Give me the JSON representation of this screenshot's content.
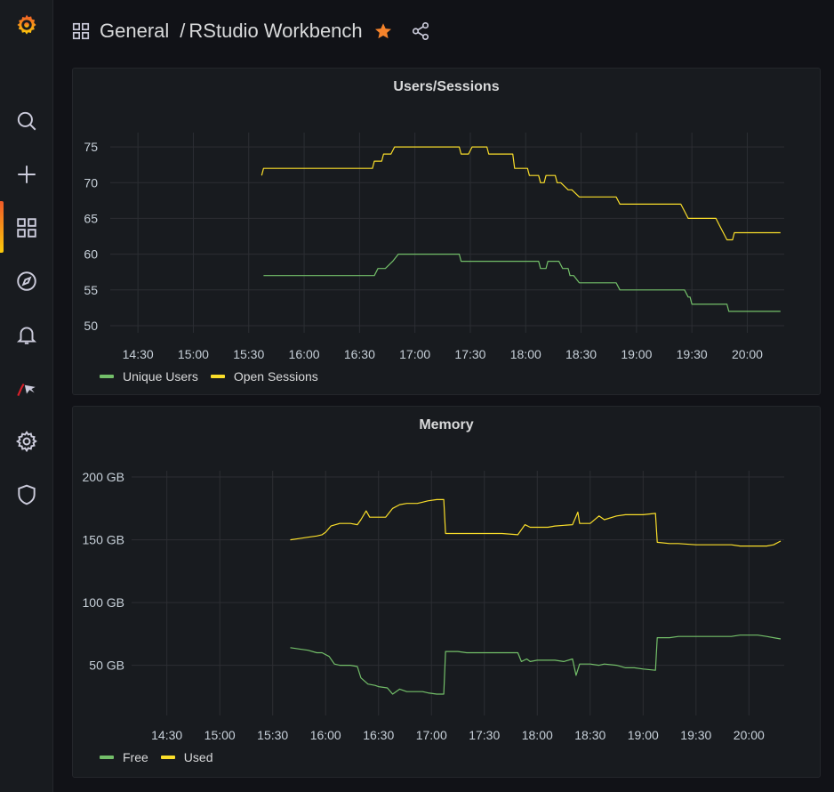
{
  "breadcrumb": {
    "folder": "General",
    "separator": "/",
    "title": "RStudio Workbench"
  },
  "colors": {
    "green": "#73bf69",
    "yellow": "#fade2a",
    "grid": "#2c2e33",
    "orange": "#f5832b"
  },
  "sidebar": {
    "items": [
      {
        "icon": "search-icon"
      },
      {
        "icon": "plus-icon"
      },
      {
        "icon": "dashboards-icon"
      },
      {
        "icon": "explore-icon"
      },
      {
        "icon": "bell-icon"
      },
      {
        "icon": "rstudio-logo-icon"
      },
      {
        "icon": "gear-icon"
      },
      {
        "icon": "shield-icon"
      }
    ]
  },
  "panels": [
    {
      "title": "Users/Sessions",
      "legend": [
        "Unique Users",
        "Open Sessions"
      ],
      "chart_data": {
        "type": "line",
        "x_ticks": [
          "14:30",
          "15:00",
          "15:30",
          "16:00",
          "16:30",
          "17:00",
          "17:30",
          "18:00",
          "18:30",
          "19:00",
          "19:30",
          "20:00"
        ],
        "y_ticks": [
          "50",
          "55",
          "60",
          "65",
          "70",
          "75"
        ],
        "ylim": [
          49,
          77
        ],
        "xlim": [
          "14:15",
          "20:20"
        ],
        "series": [
          {
            "name": "Unique Users",
            "color": "#73bf69",
            "x": [
              "15:38",
              "16:38",
              "16:40",
              "16:44",
              "16:48",
              "16:51",
              "17:24",
              "17:25",
              "18:07",
              "18:08",
              "18:11",
              "18:12",
              "18:17",
              "18:18",
              "18:20",
              "18:23",
              "18:24",
              "18:26",
              "18:29",
              "18:31",
              "18:49",
              "18:51",
              "19:26",
              "19:28",
              "19:29",
              "19:30",
              "19:49",
              "19:50",
              "20:18"
            ],
            "y": [
              57,
              57,
              58,
              58,
              59,
              60,
              60,
              59,
              59,
              58,
              58,
              59,
              59,
              59,
              58,
              58,
              57,
              57,
              56,
              56,
              56,
              55,
              55,
              54,
              54,
              53,
              53,
              52,
              52
            ]
          },
          {
            "name": "Open Sessions",
            "color": "#fade2a",
            "x": [
              "15:37",
              "15:38",
              "16:37",
              "16:38",
              "16:40",
              "16:42",
              "16:43",
              "16:44",
              "16:47",
              "16:49",
              "17:24",
              "17:25",
              "17:29",
              "17:31",
              "17:39",
              "17:40",
              "17:45",
              "17:46",
              "17:53",
              "17:54",
              "18:01",
              "18:02",
              "18:07",
              "18:08",
              "18:10",
              "18:11",
              "18:16",
              "18:17",
              "18:19",
              "18:23",
              "18:25",
              "18:29",
              "18:31",
              "18:49",
              "18:51",
              "19:24",
              "19:26",
              "19:28",
              "19:43",
              "19:45",
              "19:47",
              "19:49",
              "19:52",
              "19:53",
              "20:18"
            ],
            "y": [
              71,
              72,
              72,
              73,
              73,
              73,
              74,
              74,
              74,
              75,
              75,
              74,
              74,
              75,
              75,
              74,
              74,
              74,
              74,
              72,
              72,
              71,
              71,
              70,
              70,
              71,
              71,
              70,
              70,
              69,
              69,
              68,
              68,
              68,
              67,
              67,
              66,
              65,
              65,
              64,
              63,
              62,
              62,
              63,
              63
            ]
          }
        ]
      }
    },
    {
      "title": "Memory",
      "legend": [
        "Free",
        "Used"
      ],
      "chart_data": {
        "type": "line",
        "x_ticks": [
          "14:30",
          "15:00",
          "15:30",
          "16:00",
          "16:30",
          "17:00",
          "17:30",
          "18:00",
          "18:30",
          "19:00",
          "19:30",
          "20:00"
        ],
        "y_ticks": [
          "50 GB",
          "100 GB",
          "150 GB",
          "200 GB"
        ],
        "ylim": [
          10,
          205
        ],
        "xlim": [
          "14:10",
          "20:20"
        ],
        "series": [
          {
            "name": "Free",
            "color": "#73bf69",
            "x": [
              "15:40",
              "15:45",
              "15:50",
              "15:55",
              "15:58",
              "16:02",
              "16:05",
              "16:08",
              "16:10",
              "16:14",
              "16:18",
              "16:20",
              "16:24",
              "16:28",
              "16:30",
              "16:35",
              "16:38",
              "16:42",
              "16:46",
              "16:52",
              "16:55",
              "16:58",
              "17:03",
              "17:07",
              "17:08",
              "17:15",
              "17:20",
              "17:30",
              "17:40",
              "17:49",
              "17:51",
              "17:54",
              "17:56",
              "18:00",
              "18:06",
              "18:10",
              "18:15",
              "18:20",
              "18:22",
              "18:24",
              "18:30",
              "18:35",
              "18:38",
              "18:45",
              "18:50",
              "18:55",
              "19:00",
              "19:07",
              "19:08",
              "19:15",
              "19:20",
              "19:30",
              "19:40",
              "19:50",
              "19:55",
              "20:00",
              "20:05",
              "20:10",
              "20:14",
              "20:18"
            ],
            "y": [
              64,
              63,
              62,
              60,
              60,
              57,
              51,
              50,
              50,
              50,
              49,
              40,
              35,
              34,
              33,
              32,
              27,
              31,
              29,
              29,
              29,
              28,
              27,
              27,
              61,
              61,
              60,
              60,
              60,
              60,
              53,
              55,
              53,
              54,
              54,
              54,
              53,
              55,
              42,
              51,
              51,
              50,
              51,
              50,
              48,
              48,
              47,
              46,
              72,
              72,
              73,
              73,
              73,
              73,
              74,
              74,
              74,
              73,
              72,
              71
            ]
          },
          {
            "name": "Used",
            "color": "#fade2a",
            "x": [
              "15:40",
              "15:45",
              "15:50",
              "15:55",
              "15:58",
              "16:00",
              "16:03",
              "16:08",
              "16:10",
              "16:14",
              "16:18",
              "16:20",
              "16:23",
              "16:25",
              "16:28",
              "16:34",
              "16:38",
              "16:42",
              "16:46",
              "16:52",
              "16:55",
              "16:58",
              "17:03",
              "17:07",
              "17:08",
              "17:15",
              "17:20",
              "17:30",
              "17:40",
              "17:49",
              "17:51",
              "17:53",
              "17:56",
              "18:00",
              "18:06",
              "18:10",
              "18:20",
              "18:23",
              "18:24",
              "18:30",
              "18:35",
              "18:38",
              "18:45",
              "18:50",
              "18:55",
              "19:00",
              "19:07",
              "19:08",
              "19:15",
              "19:20",
              "19:30",
              "19:40",
              "19:50",
              "19:55",
              "20:00",
              "20:05",
              "20:10",
              "20:14",
              "20:18"
            ],
            "y": [
              150,
              151,
              152,
              153,
              154,
              156,
              161,
              163,
              163,
              163,
              162,
              166,
              173,
              168,
              168,
              168,
              175,
              178,
              179,
              179,
              180,
              181,
              182,
              182,
              155,
              155,
              155,
              155,
              155,
              154,
              158,
              162,
              160,
              160,
              160,
              161,
              162,
              172,
              163,
              163,
              169,
              166,
              169,
              170,
              170,
              170,
              171,
              148,
              147,
              147,
              146,
              146,
              146,
              145,
              145,
              145,
              145,
              146,
              149
            ]
          }
        ]
      }
    }
  ]
}
